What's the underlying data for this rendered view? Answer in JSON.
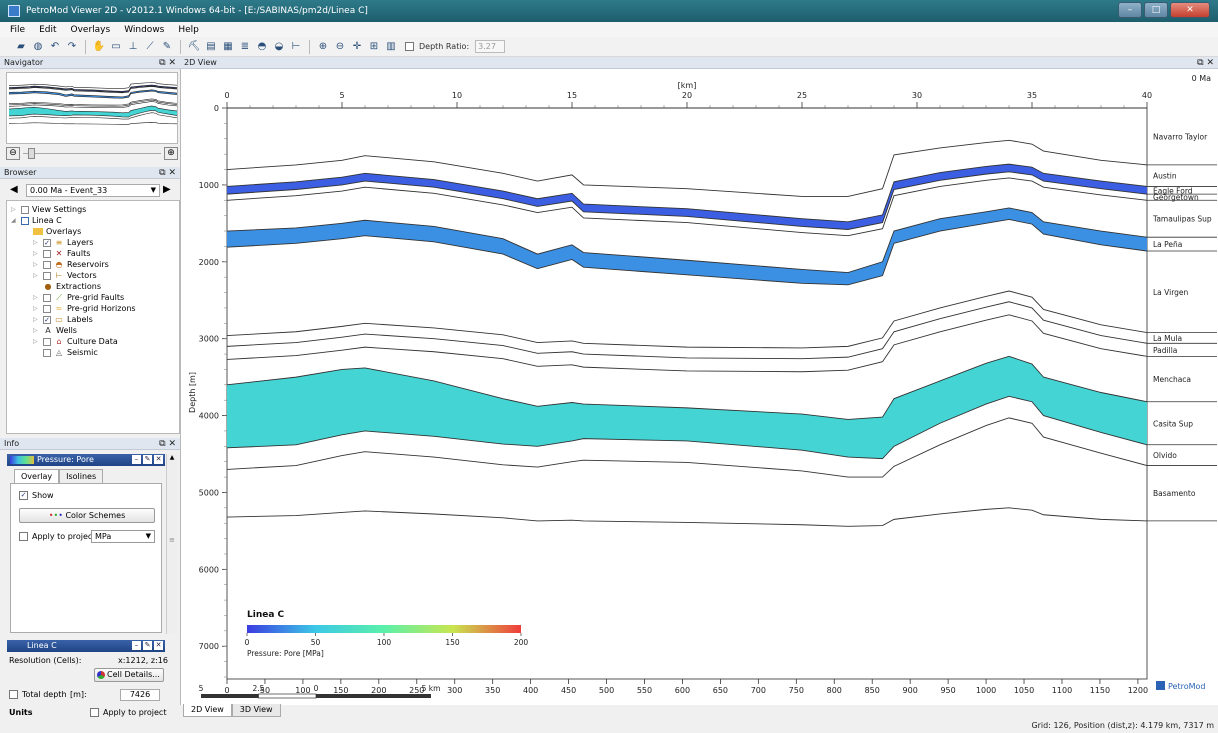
{
  "window": {
    "title": "PetroMod Viewer 2D - v2012.1 Windows 64-bit - [E:/SABINAS/pm2d/Linea C]"
  },
  "menu": [
    "File",
    "Edit",
    "Overlays",
    "Windows",
    "Help"
  ],
  "toolbar": {
    "depth_ratio_label": "Depth Ratio:",
    "depth_ratio_value": "3.27"
  },
  "navigator": {
    "title": "Navigator"
  },
  "browser": {
    "title": "Browser",
    "event_selected": "0.00 Ma - Event_33",
    "items": [
      {
        "label": "View Settings",
        "checked": false
      },
      {
        "label": "Linea C",
        "checked": false
      },
      {
        "label": "Overlays",
        "checked": false
      },
      {
        "label": "Layers",
        "checked": true
      },
      {
        "label": "Faults",
        "checked": false
      },
      {
        "label": "Reservoirs",
        "checked": false
      },
      {
        "label": "Vectors",
        "checked": false
      },
      {
        "label": "Extractions",
        "checked": false
      },
      {
        "label": "Pre-grid Faults",
        "checked": false
      },
      {
        "label": "Pre-grid Horizons",
        "checked": false
      },
      {
        "label": "Labels",
        "checked": true
      },
      {
        "label": "Wells",
        "checked": false
      },
      {
        "label": "Culture Data",
        "checked": false
      },
      {
        "label": "Seismic",
        "checked": false
      }
    ]
  },
  "info": {
    "title": "Info",
    "overlay_name": "Pressure: Pore",
    "tabs": [
      "Overlay",
      "Isolines"
    ],
    "show_label": "Show",
    "show_checked": true,
    "color_schemes_label": "Color Schemes",
    "apply_to_project_label": "Apply to project",
    "unit_selected": "MPa"
  },
  "linea": {
    "title": "Linea C",
    "resolution_label": "Resolution (Cells):",
    "resolution_value": "x:1212, z:16",
    "cell_details_label": "Cell Details...",
    "total_depth_label": "Total depth",
    "total_depth_unit": "[m]:",
    "total_depth_value": "7426",
    "units_label": "Units",
    "apply_to_project_label": "Apply to project"
  },
  "view": {
    "title": "2D View",
    "age_label": "0 Ma",
    "tabs": [
      "2D View",
      "3D View"
    ],
    "brand": "PetroMod",
    "scale_bar_labels": [
      "5",
      "2.5",
      "0",
      "5 km"
    ]
  },
  "status": {
    "text": "Grid: 126, Position (dist,z): 4.179 km, 7317 m"
  },
  "colors": {
    "eagle_ford": "#3538e6",
    "la_pena": "#35c4e6",
    "menchaca": "#5cf0a8"
  },
  "chart_data": {
    "type": "cross-section",
    "title": "Linea C",
    "x_top": {
      "label": "[km]",
      "ticks": [
        0,
        5,
        10,
        15,
        20,
        25,
        30,
        35,
        40
      ],
      "range": [
        0,
        40
      ]
    },
    "x_bottom": {
      "ticks": [
        0,
        50,
        100,
        150,
        200,
        250,
        300,
        350,
        400,
        450,
        500,
        550,
        600,
        650,
        700,
        750,
        800,
        850,
        900,
        950,
        1000,
        1050,
        1100,
        1150,
        1200
      ],
      "range": [
        0,
        1212
      ]
    },
    "y": {
      "label": "Depth [m]",
      "ticks": [
        0,
        1000,
        2000,
        3000,
        4000,
        5000,
        6000,
        7000
      ],
      "range": [
        0,
        7426
      ]
    },
    "formations": [
      "Navarro Taylor",
      "Austin",
      "Eagle Ford",
      "Georgetown",
      "Tamaulipas Sup",
      "La Peña",
      "La Virgen",
      "La Mula",
      "Padilla",
      "Menchaca",
      "Casita Sup",
      "Olvido",
      "Basamento"
    ],
    "colorbar": {
      "label": "Pressure: Pore [MPa]",
      "ticks": [
        0,
        50,
        100,
        150,
        200
      ],
      "range": [
        0,
        200
      ]
    },
    "control_x_km": [
      0,
      3,
      5,
      6,
      9,
      12,
      13.5,
      15,
      15.5,
      20,
      25,
      27,
      28.5,
      29,
      31,
      33,
      34,
      35,
      35.5,
      38,
      40
    ],
    "horizons_m": [
      [
        800,
        740,
        680,
        620,
        700,
        850,
        950,
        870,
        1000,
        1050,
        1150,
        1150,
        1050,
        610,
        520,
        450,
        420,
        470,
        560,
        680,
        740
      ],
      [
        1020,
        960,
        900,
        850,
        930,
        1080,
        1180,
        1110,
        1250,
        1310,
        1440,
        1480,
        1390,
        960,
        840,
        760,
        730,
        770,
        850,
        950,
        1020
      ],
      [
        1120,
        1060,
        1000,
        950,
        1030,
        1180,
        1280,
        1210,
        1350,
        1410,
        1540,
        1580,
        1490,
        1060,
        940,
        860,
        830,
        870,
        950,
        1050,
        1120
      ],
      [
        1200,
        1140,
        1080,
        1030,
        1110,
        1260,
        1360,
        1290,
        1430,
        1490,
        1620,
        1660,
        1570,
        1140,
        1020,
        940,
        910,
        950,
        1030,
        1130,
        1200
      ],
      [
        1600,
        1560,
        1500,
        1460,
        1540,
        1700,
        1900,
        1780,
        1880,
        1980,
        2100,
        2140,
        2000,
        1600,
        1440,
        1350,
        1300,
        1360,
        1480,
        1600,
        1680
      ],
      [
        1810,
        1760,
        1700,
        1660,
        1740,
        1900,
        2090,
        1970,
        2070,
        2170,
        2280,
        2300,
        2180,
        1760,
        1600,
        1500,
        1450,
        1510,
        1640,
        1780,
        1860
      ],
      [
        2960,
        2910,
        2840,
        2800,
        2860,
        2950,
        3050,
        3030,
        3060,
        3110,
        3120,
        3100,
        2990,
        2770,
        2600,
        2450,
        2380,
        2460,
        2620,
        2820,
        2920
      ],
      [
        3100,
        3050,
        2980,
        2940,
        3000,
        3090,
        3190,
        3170,
        3200,
        3250,
        3260,
        3240,
        3130,
        2910,
        2740,
        2590,
        2520,
        2600,
        2760,
        2960,
        3060
      ],
      [
        3270,
        3220,
        3150,
        3110,
        3170,
        3260,
        3360,
        3340,
        3370,
        3420,
        3430,
        3410,
        3300,
        3080,
        2910,
        2760,
        2690,
        2770,
        2930,
        3130,
        3230
      ],
      [
        3600,
        3500,
        3400,
        3380,
        3550,
        3780,
        3880,
        3830,
        3850,
        3900,
        3980,
        4050,
        4020,
        3780,
        3550,
        3320,
        3230,
        3330,
        3500,
        3700,
        3820
      ],
      [
        4420,
        4380,
        4250,
        4200,
        4270,
        4370,
        4400,
        4330,
        4300,
        4330,
        4450,
        4540,
        4560,
        4400,
        4100,
        3850,
        3750,
        3820,
        4000,
        4220,
        4380
      ],
      [
        4700,
        4650,
        4520,
        4470,
        4540,
        4640,
        4670,
        4600,
        4580,
        4610,
        4720,
        4800,
        4800,
        4660,
        4380,
        4130,
        4030,
        4100,
        4280,
        4490,
        4650
      ],
      [
        5320,
        5300,
        5260,
        5240,
        5280,
        5330,
        5370,
        5360,
        5370,
        5390,
        5420,
        5440,
        5430,
        5350,
        5280,
        5220,
        5200,
        5230,
        5290,
        5350,
        5370
      ]
    ],
    "colored_units": [
      {
        "top_index": 1,
        "bottom_index": 2,
        "pressure_mpa": 12
      },
      {
        "top_index": 4,
        "bottom_index": 5,
        "pressure_mpa": 30
      },
      {
        "top_index": 9,
        "bottom_index": 10,
        "pressure_mpa": 65
      }
    ]
  }
}
